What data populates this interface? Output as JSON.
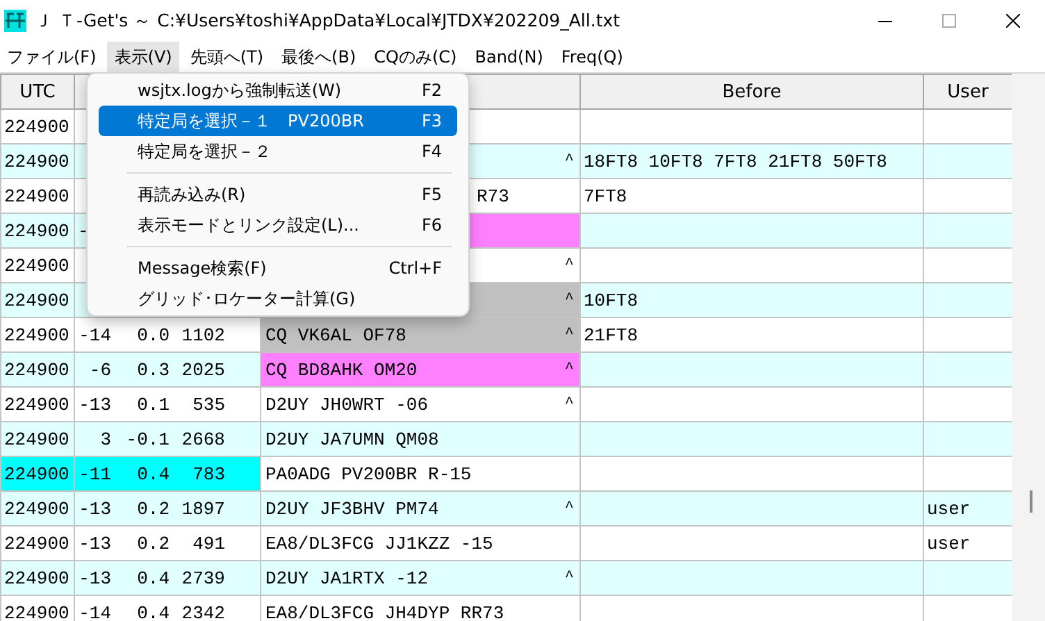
{
  "window": {
    "title": "Ｊ Ｔ-Get's ～ C:¥Users¥toshi¥AppData¥Local¥JTDX¥202209_All.txt"
  },
  "menu_bar": [
    {
      "label": "ファイル(F)",
      "selected": false
    },
    {
      "label": "表示(V)",
      "selected": true
    },
    {
      "label": "先頭へ(T)",
      "selected": false
    },
    {
      "label": "最後へ(B)",
      "selected": false
    },
    {
      "label": "CQのみ(C)",
      "selected": false
    },
    {
      "label": "Band(N)",
      "selected": false
    },
    {
      "label": "Freq(Q)",
      "selected": false
    }
  ],
  "table": {
    "columns": {
      "utc": "UTC",
      "before": "Before",
      "user": "User"
    },
    "rows": [
      {
        "utc": "224900",
        "selected": false
      },
      {
        "utc": "224900",
        "mark": "^",
        "before": "18FT8 10FT8 7FT8 21FT8 50FT8",
        "selected": false
      },
      {
        "utc": "224900",
        "message_tail": "R73",
        "before": "7FT8",
        "selected": false
      },
      {
        "utc": "224900",
        "snr_head": "-",
        "color": "#ff80ff",
        "selected": false
      },
      {
        "utc": "224900",
        "mark": "^",
        "selected": false
      },
      {
        "utc": "224900",
        "mark": "^",
        "color": "#c0c0c0",
        "before": "10FT8",
        "selected": false
      },
      {
        "utc": "224900",
        "snr": "-14",
        "dt": "0.0",
        "freq": "1102",
        "message": "CQ VK6AL OF78",
        "mark": "^",
        "color": "#c0c0c0",
        "before": "21FT8",
        "selected": false
      },
      {
        "utc": "224900",
        "snr": "-6",
        "dt": "0.3",
        "freq": "2025",
        "message": "CQ BD8AHK OM20",
        "mark": "^",
        "color": "#ff80ff",
        "selected": false
      },
      {
        "utc": "224900",
        "snr": "-13",
        "dt": "0.1",
        "freq": "535",
        "message": "D2UY JH0WRT -06",
        "mark": "^",
        "selected": false
      },
      {
        "utc": "224900",
        "snr": "3",
        "dt": "-0.1",
        "freq": "2668",
        "message": "D2UY JA7UMN QM08",
        "selected": false
      },
      {
        "utc": "224900",
        "snr": "-11",
        "dt": "0.4",
        "freq": "783",
        "message": "PA0ADG PV200BR R-15",
        "selected": true
      },
      {
        "utc": "224900",
        "snr": "-13",
        "dt": "0.2",
        "freq": "1897",
        "message": "D2UY JF3BHV PM74",
        "mark": "^",
        "user": "user",
        "selected": false
      },
      {
        "utc": "224900",
        "snr": "-13",
        "dt": "0.2",
        "freq": "491",
        "message": "EA8/DL3FCG JJ1KZZ -15",
        "user": "user",
        "selected": false
      },
      {
        "utc": "224900",
        "snr": "-13",
        "dt": "0.4",
        "freq": "2739",
        "message": "D2UY JA1RTX -12",
        "mark": "^",
        "selected": false
      },
      {
        "utc": "224900",
        "snr": "-14",
        "dt": "0.4",
        "freq": "2342",
        "message": "EA8/DL3FCG JH4DYP RR73",
        "selected": false
      }
    ]
  },
  "popup_menu": {
    "items": [
      {
        "kind": "item",
        "label": "wsjtx.logから強制転送(W)",
        "shortcut": "F2",
        "selected": false
      },
      {
        "kind": "item",
        "label": "特定局を選択－１　PV200BR",
        "shortcut": "F3",
        "selected": true
      },
      {
        "kind": "item",
        "label": "特定局を選択－２",
        "shortcut": "F4",
        "selected": false
      },
      {
        "kind": "separator"
      },
      {
        "kind": "item",
        "label": "再読み込み(R)",
        "shortcut": "F5",
        "selected": false
      },
      {
        "kind": "item",
        "label": "表示モードとリンク設定(L)...",
        "shortcut": "F6",
        "selected": false
      },
      {
        "kind": "separator"
      },
      {
        "kind": "item",
        "label": "Message検索(F)",
        "shortcut": "Ctrl+F",
        "selected": false
      },
      {
        "kind": "item",
        "label": "グリッド･ロケーター計算(G)",
        "selected": false
      }
    ]
  }
}
